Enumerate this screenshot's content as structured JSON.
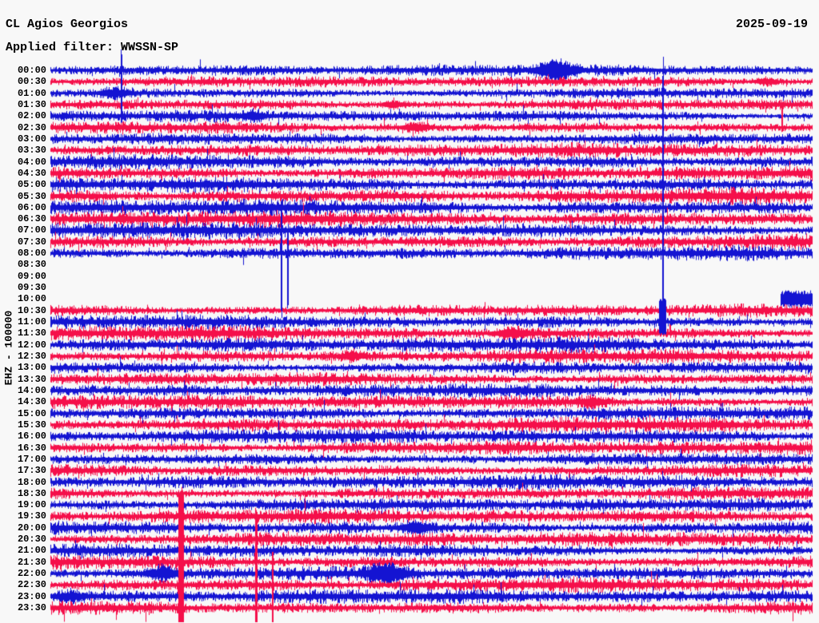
{
  "header": {
    "station": "CL Agios Georgios",
    "date": "2025-09-19",
    "filter": "Applied filter: WWSSN-SP"
  },
  "y_axis": {
    "scale_label": "EHZ - 100000"
  },
  "chart_data": {
    "type": "line",
    "subtype": "helicorder-day-plot",
    "title": "CL Agios Georgios",
    "date": "2025-09-19",
    "filter": "WWSSN-SP",
    "channel": "EHZ",
    "scale_value": "100000",
    "row_interval_min": 30,
    "legend_position": "none",
    "grid": false,
    "colors": {
      "even_row": "#1414d2",
      "odd_row": "#f50f4a",
      "background": "#f8f8f8",
      "text": "#000000"
    },
    "data_gap": {
      "start": "08:19",
      "end": "10:29"
    },
    "rows": [
      {
        "t": "00:00",
        "amp": 7.0,
        "seg": [
          [
            0,
            1
          ]
        ]
      },
      {
        "t": "00:30",
        "amp": 6.5,
        "seg": [
          [
            0,
            1
          ]
        ]
      },
      {
        "t": "01:00",
        "amp": 7.0,
        "seg": [
          [
            0,
            1
          ]
        ]
      },
      {
        "t": "01:30",
        "amp": 7.5,
        "seg": [
          [
            0,
            1
          ]
        ]
      },
      {
        "t": "02:00",
        "amp": 7.0,
        "seg": [
          [
            0,
            1
          ]
        ]
      },
      {
        "t": "02:30",
        "amp": 7.5,
        "seg": [
          [
            0,
            1
          ]
        ]
      },
      {
        "t": "03:00",
        "amp": 8.0,
        "seg": [
          [
            0,
            1
          ]
        ]
      },
      {
        "t": "03:30",
        "amp": 8.5,
        "seg": [
          [
            0,
            1
          ]
        ]
      },
      {
        "t": "04:00",
        "amp": 9.0,
        "seg": [
          [
            0,
            1
          ]
        ]
      },
      {
        "t": "04:30",
        "amp": 9.0,
        "seg": [
          [
            0,
            1
          ]
        ]
      },
      {
        "t": "05:00",
        "amp": 9.5,
        "seg": [
          [
            0,
            1
          ]
        ]
      },
      {
        "t": "05:30",
        "amp": 10.0,
        "seg": [
          [
            0,
            1
          ]
        ]
      },
      {
        "t": "06:00",
        "amp": 10.0,
        "seg": [
          [
            0,
            1
          ]
        ]
      },
      {
        "t": "06:30",
        "amp": 10.0,
        "seg": [
          [
            0,
            1
          ]
        ]
      },
      {
        "t": "07:00",
        "amp": 9.5,
        "seg": [
          [
            0,
            1
          ]
        ]
      },
      {
        "t": "07:30",
        "amp": 9.0,
        "seg": [
          [
            0,
            1
          ]
        ]
      },
      {
        "t": "08:00",
        "amp": 8.5,
        "seg": [
          [
            0,
            1
          ]
        ]
      },
      {
        "t": "08:30",
        "amp": 0,
        "seg": []
      },
      {
        "t": "09:00",
        "amp": 0,
        "seg": []
      },
      {
        "t": "09:30",
        "amp": 0,
        "seg": []
      },
      {
        "t": "10:00",
        "amp": 11.0,
        "seg": [
          [
            0.958,
            1
          ]
        ],
        "solid": true
      },
      {
        "t": "10:30",
        "amp": 8.0,
        "seg": [
          [
            0,
            1
          ]
        ]
      },
      {
        "t": "11:00",
        "amp": 8.5,
        "seg": [
          [
            0,
            1
          ]
        ]
      },
      {
        "t": "11:30",
        "amp": 9.0,
        "seg": [
          [
            0,
            1
          ]
        ]
      },
      {
        "t": "12:00",
        "amp": 9.0,
        "seg": [
          [
            0,
            1
          ]
        ]
      },
      {
        "t": "12:30",
        "amp": 8.5,
        "seg": [
          [
            0,
            1
          ]
        ]
      },
      {
        "t": "13:00",
        "amp": 8.0,
        "seg": [
          [
            0,
            1
          ]
        ]
      },
      {
        "t": "13:30",
        "amp": 8.0,
        "seg": [
          [
            0,
            1
          ]
        ]
      },
      {
        "t": "14:00",
        "amp": 8.0,
        "seg": [
          [
            0,
            1
          ]
        ]
      },
      {
        "t": "14:30",
        "amp": 8.5,
        "seg": [
          [
            0,
            1
          ]
        ]
      },
      {
        "t": "15:00",
        "amp": 9.0,
        "seg": [
          [
            0,
            1
          ]
        ]
      },
      {
        "t": "15:30",
        "amp": 9.0,
        "seg": [
          [
            0,
            1
          ]
        ]
      },
      {
        "t": "16:00",
        "amp": 8.5,
        "seg": [
          [
            0,
            1
          ]
        ]
      },
      {
        "t": "16:30",
        "amp": 8.5,
        "seg": [
          [
            0,
            1
          ]
        ]
      },
      {
        "t": "17:00",
        "amp": 8.0,
        "seg": [
          [
            0,
            1
          ]
        ]
      },
      {
        "t": "17:30",
        "amp": 8.5,
        "seg": [
          [
            0,
            1
          ]
        ]
      },
      {
        "t": "18:00",
        "amp": 8.5,
        "seg": [
          [
            0,
            1
          ]
        ]
      },
      {
        "t": "18:30",
        "amp": 8.0,
        "seg": [
          [
            0,
            1
          ]
        ]
      },
      {
        "t": "19:00",
        "amp": 8.0,
        "seg": [
          [
            0,
            1
          ]
        ]
      },
      {
        "t": "19:30",
        "amp": 8.5,
        "seg": [
          [
            0,
            1
          ]
        ]
      },
      {
        "t": "20:00",
        "amp": 8.5,
        "seg": [
          [
            0,
            1
          ]
        ]
      },
      {
        "t": "20:30",
        "amp": 8.5,
        "seg": [
          [
            0,
            1
          ]
        ]
      },
      {
        "t": "21:00",
        "amp": 8.0,
        "seg": [
          [
            0,
            1
          ]
        ]
      },
      {
        "t": "21:30",
        "amp": 8.5,
        "seg": [
          [
            0,
            1
          ]
        ]
      },
      {
        "t": "22:00",
        "amp": 8.0,
        "seg": [
          [
            0,
            1
          ]
        ]
      },
      {
        "t": "22:30",
        "amp": 8.5,
        "seg": [
          [
            0,
            1
          ]
        ]
      },
      {
        "t": "23:00",
        "amp": 8.5,
        "seg": [
          [
            0,
            1
          ]
        ]
      },
      {
        "t": "23:30",
        "amp": 8.5,
        "seg": [
          [
            0,
            1
          ]
        ]
      }
    ],
    "bursts": [
      {
        "row": "00:00",
        "minute": 19.9,
        "amp": 2.6,
        "width": 1.2
      },
      {
        "row": "00:30",
        "minute": 28.2,
        "amp": 1.6,
        "width": 0.8
      },
      {
        "row": "01:00",
        "minute": 2.5,
        "amp": 1.8,
        "width": 1.0
      },
      {
        "row": "01:30",
        "minute": 13.5,
        "amp": 1.5,
        "width": 0.8
      },
      {
        "row": "02:00",
        "minute": 8.0,
        "amp": 1.5,
        "width": 0.8
      },
      {
        "row": "02:30",
        "minute": 14.4,
        "amp": 1.6,
        "width": 0.9
      },
      {
        "row": "11:30",
        "minute": 18.2,
        "amp": 1.6,
        "width": 1.0
      },
      {
        "row": "12:30",
        "minute": 11.9,
        "amp": 1.5,
        "width": 0.8
      },
      {
        "row": "14:30",
        "minute": 21.3,
        "amp": 1.6,
        "width": 1.0
      },
      {
        "row": "20:00",
        "minute": 14.4,
        "amp": 1.7,
        "width": 1.2
      },
      {
        "row": "22:00",
        "minute": 4.4,
        "amp": 1.9,
        "width": 1.0
      },
      {
        "row": "22:00",
        "minute": 13.2,
        "amp": 2.4,
        "width": 1.4
      },
      {
        "row": "23:00",
        "minute": 0.8,
        "amp": 1.6,
        "width": 1.0
      }
    ],
    "spikes": [
      {
        "row": "02:00",
        "minute": 2.8,
        "up": 88,
        "down": 9,
        "w": 2
      },
      {
        "row": "02:30",
        "minute": 28.8,
        "up": 30,
        "down": 6,
        "w": 2
      },
      {
        "row": "08:00",
        "minute": 9.1,
        "up": 72,
        "down": 83,
        "w": 2
      },
      {
        "row": "08:00",
        "minute": 9.35,
        "up": 28,
        "down": 75,
        "w": 2
      },
      {
        "row": "11:00",
        "minute": 24.1,
        "up": 350,
        "down": 16,
        "w": 2
      },
      {
        "row": "11:00",
        "minute": 24.1,
        "up": 30,
        "down": 16,
        "w": 9
      },
      {
        "row": "21:30",
        "minute": 5.15,
        "up": 95,
        "down": 90,
        "w": 7
      },
      {
        "row": "21:30",
        "minute": 8.1,
        "up": 68,
        "down": 90,
        "w": 3
      },
      {
        "row": "22:30",
        "minute": 8.75,
        "up": 45,
        "down": 55,
        "w": 2
      }
    ]
  }
}
